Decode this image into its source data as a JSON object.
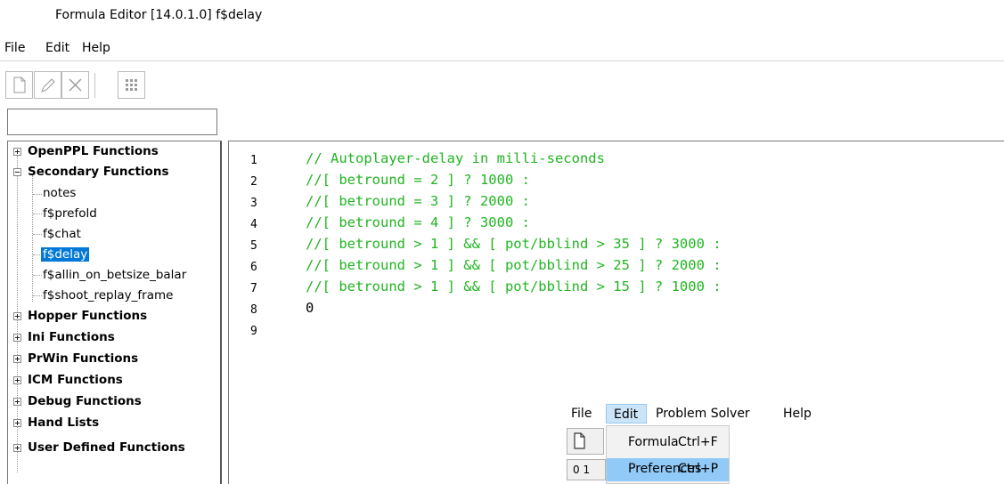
{
  "window": {
    "title": "Formula Editor [14.0.1.0] f$delay"
  },
  "menubar": {
    "file": "File",
    "edit": "Edit",
    "help": "Help"
  },
  "tree": {
    "groups": [
      {
        "label": "OpenPPL Functions",
        "expanded": false
      },
      {
        "label": "Secondary Functions",
        "expanded": true
      },
      {
        "label": "Hopper Functions",
        "expanded": false
      },
      {
        "label": "Ini Functions",
        "expanded": false
      },
      {
        "label": "PrWin Functions",
        "expanded": false
      },
      {
        "label": "ICM Functions",
        "expanded": false
      },
      {
        "label": "Debug Functions",
        "expanded": false
      },
      {
        "label": "Hand Lists",
        "expanded": false
      },
      {
        "label": "User Defined Functions",
        "expanded": false
      }
    ],
    "secondary_children": [
      "notes",
      "f$prefold",
      "f$chat",
      "f$delay",
      "f$allin_on_betsize_balar",
      "f$shoot_replay_frame"
    ],
    "selected": "f$delay"
  },
  "editor": {
    "line_numbers": [
      "1",
      "2",
      "3",
      "4",
      "5",
      "6",
      "7",
      "8",
      "9"
    ],
    "lines": [
      "// Autoplayer-delay in milli-seconds",
      "//[ betround = 2 ] ? 1000 :",
      "//[ betround = 3 ] ? 2000 :",
      "//[ betround = 4 ] ? 3000 :",
      "//[ betround > 1 ] && [ pot/bblind > 35 ] ? 3000 :",
      "//[ betround > 1 ] && [ pot/bblind > 25 ] ? 2000 :",
      "//[ betround > 1 ] && [ pot/bblind > 15 ] ? 1000 :",
      "0",
      ""
    ],
    "comment_color": "#21b521"
  },
  "overlay": {
    "menubar": {
      "file": "File",
      "edit": "Edit",
      "problem_solver": "Problem Solver",
      "help": "Help"
    },
    "dropdown": [
      {
        "label": "Formula",
        "shortcut": "Ctrl+F"
      },
      {
        "label": "Preferences",
        "shortcut": "Ctrl+P"
      }
    ],
    "mini_row": "0 1"
  }
}
